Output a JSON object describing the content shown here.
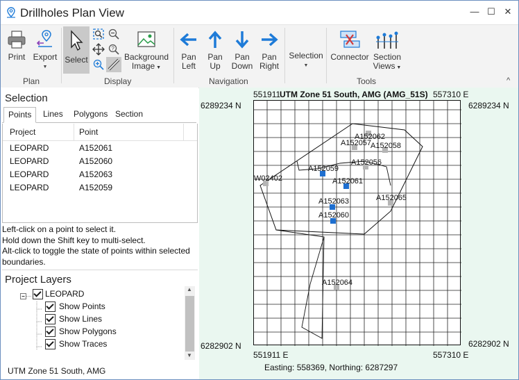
{
  "window": {
    "title": "Drillholes Plan View",
    "controls": [
      "—",
      "☐",
      "✕"
    ]
  },
  "ribbon": {
    "groups": {
      "plan": "Plan",
      "display": "Display",
      "navigation": "Navigation",
      "tools": "Tools"
    },
    "buttons": {
      "print": "Print",
      "export": "Export",
      "select": "Select",
      "background_image_1": "Background",
      "background_image_2": "Image",
      "pan_left_1": "Pan",
      "pan_left_2": "Left",
      "pan_up_1": "Pan",
      "pan_up_2": "Up",
      "pan_down_1": "Pan",
      "pan_down_2": "Down",
      "pan_right_1": "Pan",
      "pan_right_2": "Right",
      "selection": "Selection",
      "connector": "Connector",
      "section_views_1": "Section",
      "section_views_2": "Views"
    },
    "colors": {
      "accent_blue": "#1e7bd8",
      "connector_red": "#d23b3b"
    }
  },
  "selection_panel": {
    "header": "Selection",
    "tabs": [
      "Points",
      "Lines",
      "Polygons",
      "Section"
    ],
    "active_tab": "Points",
    "columns": [
      "Project",
      "Point"
    ],
    "rows": [
      {
        "project": "LEOPARD",
        "point": "A152061"
      },
      {
        "project": "LEOPARD",
        "point": "A152060"
      },
      {
        "project": "LEOPARD",
        "point": "A152063"
      },
      {
        "project": "LEOPARD",
        "point": "A152059"
      }
    ],
    "help_lines": [
      "Left-click on a point to select it.",
      "Hold down the Shift key to multi-select.",
      "Alt-click to toggle the state of points within selected",
      "boundaries."
    ]
  },
  "project_layers": {
    "header": "Project Layers",
    "root": "LEOPARD",
    "children": [
      "Show Points",
      "Show Lines",
      "Show Polygons",
      "Show Traces"
    ]
  },
  "status": {
    "left": "UTM Zone 51 South, AMG",
    "map": "Easting: 558369, Northing: 6287297"
  },
  "map": {
    "title": "UTM Zone 51 South, AMG (AMG_51S)",
    "top_left_e": "551911",
    "top_right_e": "557310 E",
    "bottom_left_e": "551911 E",
    "bottom_right_e": "557310 E",
    "top_n_left": "6289234 N",
    "top_n_right": "6289234 N",
    "bottom_n_left": "6282902 N",
    "bottom_n_right": "6282902 N",
    "points": [
      {
        "label": "A152062",
        "selected": false
      },
      {
        "label": "A152057",
        "selected": false
      },
      {
        "label": "A152058",
        "selected": false
      },
      {
        "label": "A152056",
        "selected": false
      },
      {
        "label": "A152059",
        "selected": true
      },
      {
        "label": "W02402",
        "selected": false
      },
      {
        "label": "A152061",
        "selected": true
      },
      {
        "label": "A152065",
        "selected": false
      },
      {
        "label": "A152063",
        "selected": true
      },
      {
        "label": "A152060",
        "selected": true
      },
      {
        "label": "A152064",
        "selected": false
      }
    ],
    "colors": {
      "background": "#eaf7f0",
      "selected": "#1e6fd0",
      "unselected": "#b5b5b5"
    }
  }
}
